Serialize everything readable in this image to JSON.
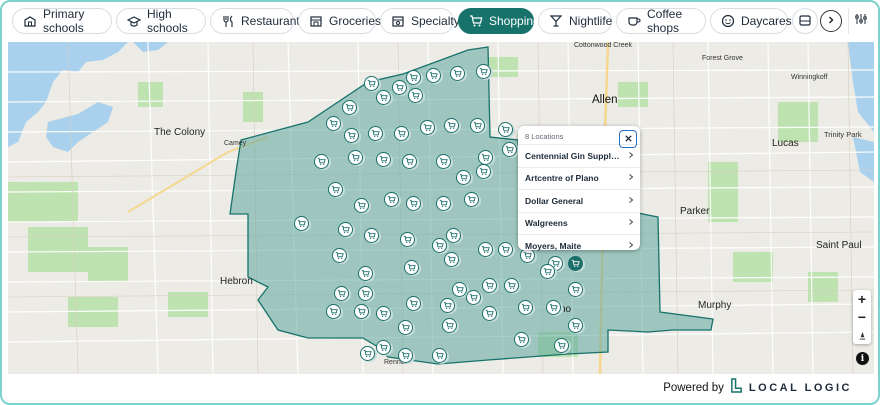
{
  "categories": [
    {
      "label": "Primary schools",
      "icon": "school-icon",
      "active": false
    },
    {
      "label": "High schools",
      "icon": "graduation-cap-icon",
      "active": false
    },
    {
      "label": "Restaurants",
      "icon": "fork-knife-icon",
      "active": false
    },
    {
      "label": "Groceries",
      "icon": "store-icon",
      "active": false
    },
    {
      "label": "Specialty",
      "icon": "specialty-store-icon",
      "active": false
    },
    {
      "label": "Shopping",
      "icon": "shopping-cart-icon",
      "active": true
    },
    {
      "label": "Nightlife",
      "icon": "cocktail-icon",
      "active": false
    },
    {
      "label": "Coffee shops",
      "icon": "coffee-cup-icon",
      "active": false
    },
    {
      "label": "Daycares",
      "icon": "smiley-icon",
      "active": false
    }
  ],
  "map": {
    "labels": {
      "the_colony": "The Colony",
      "allen": "Allen",
      "lucas": "Lucas",
      "parker": "Parker",
      "saint_paul": "Saint Paul",
      "murphy": "Murphy",
      "hebron": "Hebron",
      "trinity_park": "Trinity Park",
      "cottonwood_creek": "Cottonwood Creek",
      "forest_grove": "Forest Grove",
      "winningkoff": "Winningkoff",
      "renner": "Renner",
      "camey": "Camey",
      "plano_partial": "no"
    },
    "shaded_area_color": "#4f9d97",
    "accent": "#17726c"
  },
  "popup": {
    "count_label": "8 Locations",
    "items": [
      "Centennial Gin Supply ...",
      "Artcentre of Plano",
      "Dollar General",
      "Walgreens",
      "Moyers, Maite"
    ]
  },
  "controls": {
    "zoom_in": "+",
    "zoom_out": "−",
    "info": "i"
  },
  "footer": {
    "powered": "Powered by",
    "brand": "LOCAL LOGIC"
  }
}
